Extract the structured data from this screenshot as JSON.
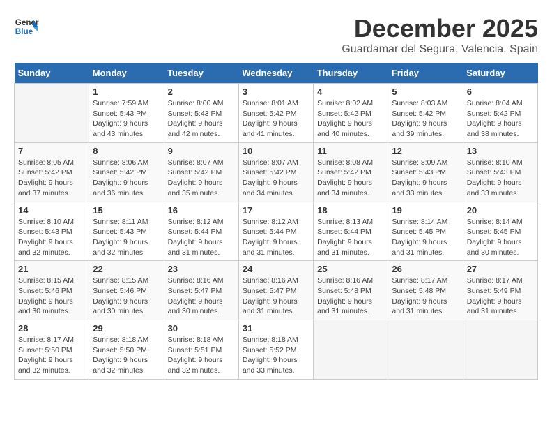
{
  "header": {
    "logo_line1": "General",
    "logo_line2": "Blue",
    "month": "December 2025",
    "location": "Guardamar del Segura, Valencia, Spain"
  },
  "weekdays": [
    "Sunday",
    "Monday",
    "Tuesday",
    "Wednesday",
    "Thursday",
    "Friday",
    "Saturday"
  ],
  "weeks": [
    [
      {
        "day": "",
        "sunrise": "",
        "sunset": "",
        "daylight": ""
      },
      {
        "day": "1",
        "sunrise": "Sunrise: 7:59 AM",
        "sunset": "Sunset: 5:43 PM",
        "daylight": "Daylight: 9 hours and 43 minutes."
      },
      {
        "day": "2",
        "sunrise": "Sunrise: 8:00 AM",
        "sunset": "Sunset: 5:43 PM",
        "daylight": "Daylight: 9 hours and 42 minutes."
      },
      {
        "day": "3",
        "sunrise": "Sunrise: 8:01 AM",
        "sunset": "Sunset: 5:42 PM",
        "daylight": "Daylight: 9 hours and 41 minutes."
      },
      {
        "day": "4",
        "sunrise": "Sunrise: 8:02 AM",
        "sunset": "Sunset: 5:42 PM",
        "daylight": "Daylight: 9 hours and 40 minutes."
      },
      {
        "day": "5",
        "sunrise": "Sunrise: 8:03 AM",
        "sunset": "Sunset: 5:42 PM",
        "daylight": "Daylight: 9 hours and 39 minutes."
      },
      {
        "day": "6",
        "sunrise": "Sunrise: 8:04 AM",
        "sunset": "Sunset: 5:42 PM",
        "daylight": "Daylight: 9 hours and 38 minutes."
      }
    ],
    [
      {
        "day": "7",
        "sunrise": "Sunrise: 8:05 AM",
        "sunset": "Sunset: 5:42 PM",
        "daylight": "Daylight: 9 hours and 37 minutes."
      },
      {
        "day": "8",
        "sunrise": "Sunrise: 8:06 AM",
        "sunset": "Sunset: 5:42 PM",
        "daylight": "Daylight: 9 hours and 36 minutes."
      },
      {
        "day": "9",
        "sunrise": "Sunrise: 8:07 AM",
        "sunset": "Sunset: 5:42 PM",
        "daylight": "Daylight: 9 hours and 35 minutes."
      },
      {
        "day": "10",
        "sunrise": "Sunrise: 8:07 AM",
        "sunset": "Sunset: 5:42 PM",
        "daylight": "Daylight: 9 hours and 34 minutes."
      },
      {
        "day": "11",
        "sunrise": "Sunrise: 8:08 AM",
        "sunset": "Sunset: 5:42 PM",
        "daylight": "Daylight: 9 hours and 34 minutes."
      },
      {
        "day": "12",
        "sunrise": "Sunrise: 8:09 AM",
        "sunset": "Sunset: 5:43 PM",
        "daylight": "Daylight: 9 hours and 33 minutes."
      },
      {
        "day": "13",
        "sunrise": "Sunrise: 8:10 AM",
        "sunset": "Sunset: 5:43 PM",
        "daylight": "Daylight: 9 hours and 33 minutes."
      }
    ],
    [
      {
        "day": "14",
        "sunrise": "Sunrise: 8:10 AM",
        "sunset": "Sunset: 5:43 PM",
        "daylight": "Daylight: 9 hours and 32 minutes."
      },
      {
        "day": "15",
        "sunrise": "Sunrise: 8:11 AM",
        "sunset": "Sunset: 5:43 PM",
        "daylight": "Daylight: 9 hours and 32 minutes."
      },
      {
        "day": "16",
        "sunrise": "Sunrise: 8:12 AM",
        "sunset": "Sunset: 5:44 PM",
        "daylight": "Daylight: 9 hours and 31 minutes."
      },
      {
        "day": "17",
        "sunrise": "Sunrise: 8:12 AM",
        "sunset": "Sunset: 5:44 PM",
        "daylight": "Daylight: 9 hours and 31 minutes."
      },
      {
        "day": "18",
        "sunrise": "Sunrise: 8:13 AM",
        "sunset": "Sunset: 5:44 PM",
        "daylight": "Daylight: 9 hours and 31 minutes."
      },
      {
        "day": "19",
        "sunrise": "Sunrise: 8:14 AM",
        "sunset": "Sunset: 5:45 PM",
        "daylight": "Daylight: 9 hours and 31 minutes."
      },
      {
        "day": "20",
        "sunrise": "Sunrise: 8:14 AM",
        "sunset": "Sunset: 5:45 PM",
        "daylight": "Daylight: 9 hours and 30 minutes."
      }
    ],
    [
      {
        "day": "21",
        "sunrise": "Sunrise: 8:15 AM",
        "sunset": "Sunset: 5:46 PM",
        "daylight": "Daylight: 9 hours and 30 minutes."
      },
      {
        "day": "22",
        "sunrise": "Sunrise: 8:15 AM",
        "sunset": "Sunset: 5:46 PM",
        "daylight": "Daylight: 9 hours and 30 minutes."
      },
      {
        "day": "23",
        "sunrise": "Sunrise: 8:16 AM",
        "sunset": "Sunset: 5:47 PM",
        "daylight": "Daylight: 9 hours and 30 minutes."
      },
      {
        "day": "24",
        "sunrise": "Sunrise: 8:16 AM",
        "sunset": "Sunset: 5:47 PM",
        "daylight": "Daylight: 9 hours and 31 minutes."
      },
      {
        "day": "25",
        "sunrise": "Sunrise: 8:16 AM",
        "sunset": "Sunset: 5:48 PM",
        "daylight": "Daylight: 9 hours and 31 minutes."
      },
      {
        "day": "26",
        "sunrise": "Sunrise: 8:17 AM",
        "sunset": "Sunset: 5:48 PM",
        "daylight": "Daylight: 9 hours and 31 minutes."
      },
      {
        "day": "27",
        "sunrise": "Sunrise: 8:17 AM",
        "sunset": "Sunset: 5:49 PM",
        "daylight": "Daylight: 9 hours and 31 minutes."
      }
    ],
    [
      {
        "day": "28",
        "sunrise": "Sunrise: 8:17 AM",
        "sunset": "Sunset: 5:50 PM",
        "daylight": "Daylight: 9 hours and 32 minutes."
      },
      {
        "day": "29",
        "sunrise": "Sunrise: 8:18 AM",
        "sunset": "Sunset: 5:50 PM",
        "daylight": "Daylight: 9 hours and 32 minutes."
      },
      {
        "day": "30",
        "sunrise": "Sunrise: 8:18 AM",
        "sunset": "Sunset: 5:51 PM",
        "daylight": "Daylight: 9 hours and 32 minutes."
      },
      {
        "day": "31",
        "sunrise": "Sunrise: 8:18 AM",
        "sunset": "Sunset: 5:52 PM",
        "daylight": "Daylight: 9 hours and 33 minutes."
      },
      {
        "day": "",
        "sunrise": "",
        "sunset": "",
        "daylight": ""
      },
      {
        "day": "",
        "sunrise": "",
        "sunset": "",
        "daylight": ""
      },
      {
        "day": "",
        "sunrise": "",
        "sunset": "",
        "daylight": ""
      }
    ]
  ]
}
